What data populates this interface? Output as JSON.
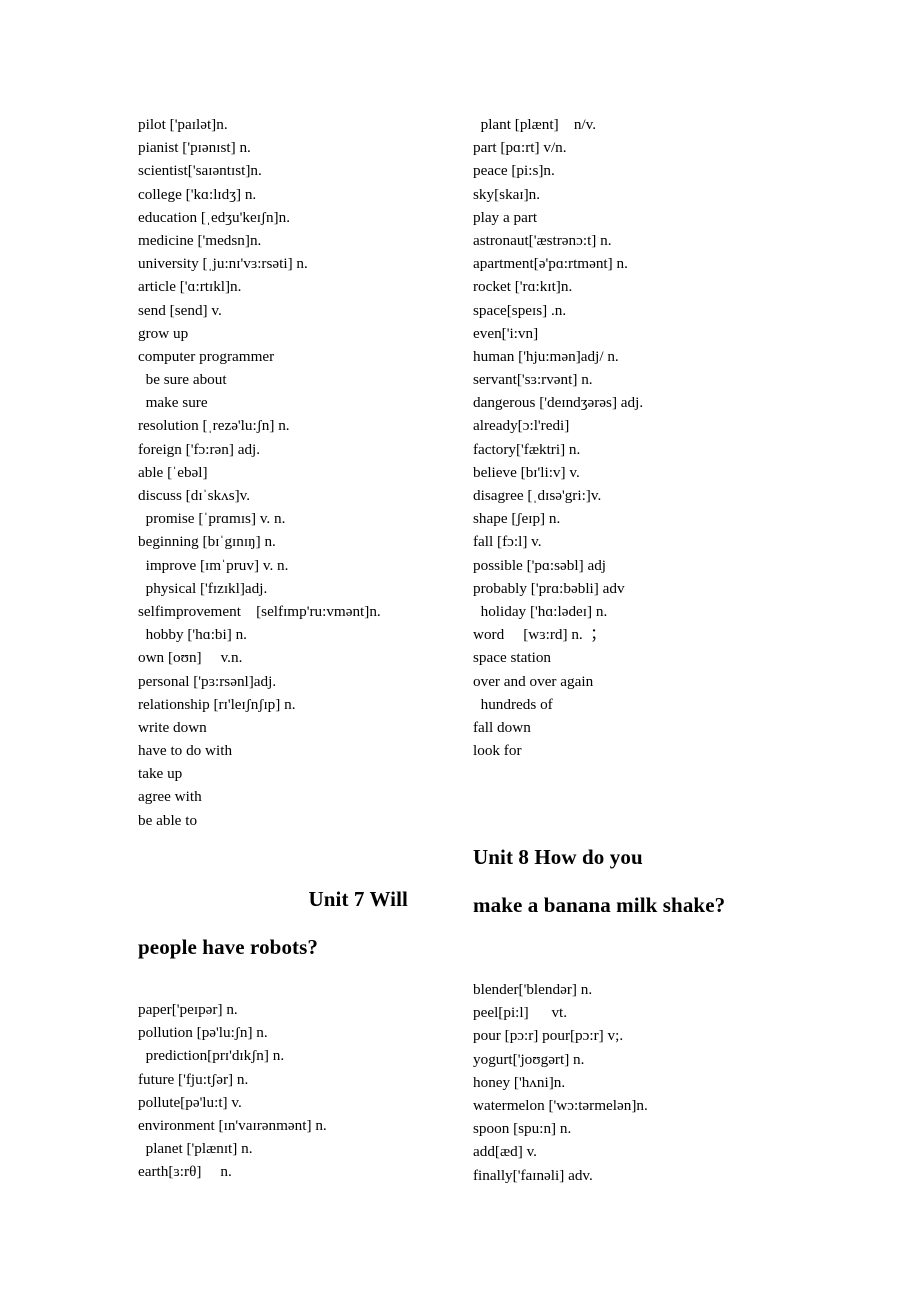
{
  "document": {
    "type": "vocabulary-word-list",
    "columns": {
      "left_top": [
        "pilot ['paɪlət]n.",
        "pianist ['pɪənɪst] n.",
        "scientist['saɪəntɪst]n.",
        "college ['kɑ:lɪdʒ] n.",
        "education [ˌedʒu'keɪʃn]n.",
        "medicine ['medsn]n.",
        "university [ˌju:nɪ'vɜ:rsəti] n.",
        "article ['ɑ:rtɪkl]n.",
        "send [send] v.",
        "grow up",
        "computer programmer",
        "  be sure about",
        "  make sure",
        "resolution [ˌrezə'lu:ʃn] n.",
        "foreign ['fɔ:rən] adj.",
        "able [ˈebəl]",
        "discuss [dɪˈskʌs]v.",
        "  promise [ˈprɑmɪs] v. n.",
        "beginning [bɪˈgɪnɪŋ] n.",
        "  improve [ɪmˈpruv] v. n.",
        "  physical ['fɪzɪkl]adj.",
        "selfimprovement    [selfɪmp'ru:vmənt]n.",
        "  hobby ['hɑ:bi] n.",
        "own [oʊn]     v.n.",
        "personal ['pɜ:rsənl]adj.",
        "relationship [rɪ'leɪʃnʃɪp] n.",
        "write down",
        "have to do with",
        "take up",
        "agree with",
        "be able to"
      ],
      "right_top": [
        "  plant [plænt]    n/v.",
        "part [pɑ:rt] v/n.",
        "peace [pi:s]n.",
        "sky[skaɪ]n.",
        "play a part",
        "astronaut['æstrənɔ:t] n.",
        "apartment[ə'pɑ:rtmənt] n.",
        "rocket ['rɑ:kɪt]n.",
        "space[speɪs] .n.",
        "even['i:vn]",
        "human ['hju:mən]adj/ n.",
        "servant['sɜ:rvənt] n.",
        "dangerous ['deɪndʒərəs] adj.",
        "already[ɔ:l'redi]",
        "factory['fæktri] n.",
        "believe [bɪ'li:v] v.",
        "disagree [ˌdɪsə'gri:]v.",
        "shape [ʃeɪp] n.",
        "fall [fɔ:l] v.",
        "possible ['pɑ:səbl] adj",
        "probably ['prɑ:bəbli] adv",
        "  holiday ['hɑ:lədeɪ] n.",
        "word     [wɜ:rd] n.  ；",
        "space station",
        "over and over again",
        "  hundreds of",
        "fall down",
        "look for"
      ],
      "left_bottom": [
        "paper['peɪpər] n.",
        "pollution [pə'lu:ʃn] n.",
        "  prediction[prɪ'dɪkʃn] n.",
        "future ['fju:tʃər] n.",
        "pollute[pə'lu:t] v.",
        "environment [ɪn'vaɪrənmənt] n.",
        "  planet ['plænɪt] n.",
        "earth[ɜ:rθ]     n."
      ],
      "right_bottom": [
        "blender['blendər] n.",
        "peel[pi:l]      vt.",
        "pour [pɔ:r] pour[pɔ:r] v;.",
        "yogurt['joʊgərt] n.",
        "honey ['hʌni]n.",
        "watermelon ['wɔ:tərmelən]n.",
        "spoon [spu:n] n.",
        "add[æd] v.",
        "finally['faɪnəli] adv."
      ]
    },
    "headings": {
      "unit7_line1": "Unit 7 Will",
      "unit7_line2": "people have robots?",
      "unit8_line1": "Unit 8 How do you",
      "unit8_line2": "make a banana milk shake?"
    }
  }
}
